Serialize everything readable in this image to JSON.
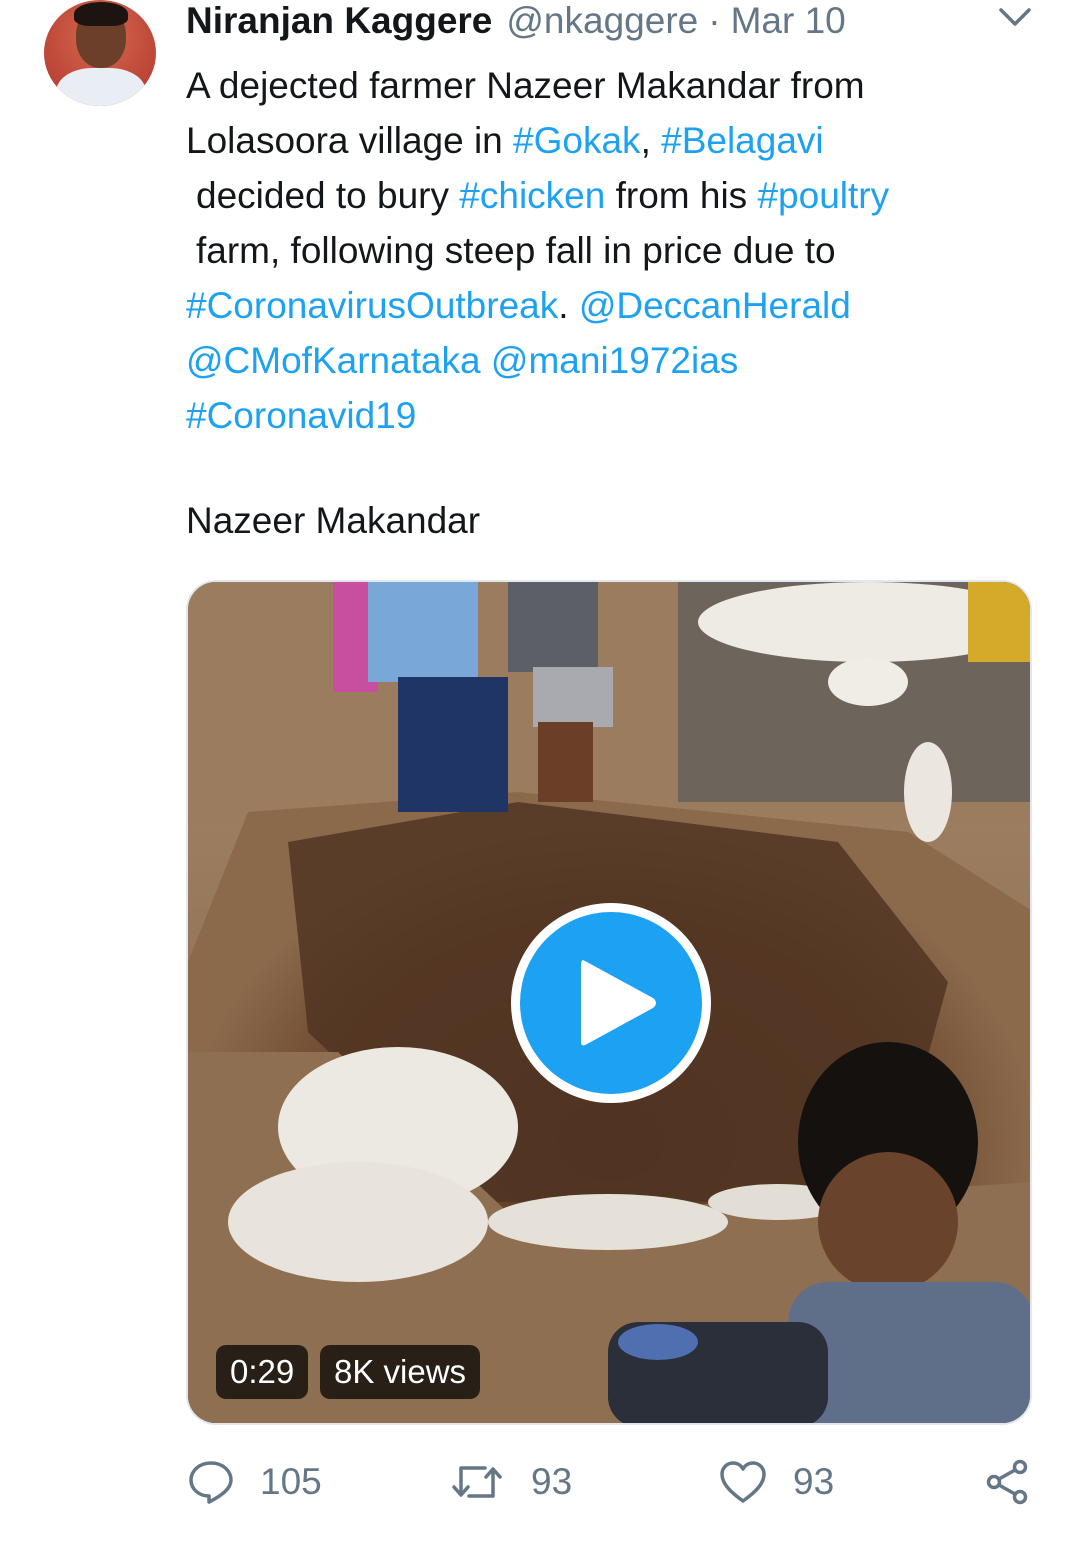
{
  "author": {
    "name": "Niranjan Kaggere",
    "handle": "@nkaggere",
    "separator": "·",
    "date": "Mar 10"
  },
  "tweet": {
    "lines": [
      [
        {
          "t": "A dejected farmer Nazeer Makandar from",
          "link": false
        }
      ],
      [
        {
          "t": "Lolasoora village in ",
          "link": false
        },
        {
          "t": "#Gokak",
          "link": true
        },
        {
          "t": ", ",
          "link": false
        },
        {
          "t": "#Belagavi",
          "link": true
        }
      ],
      [
        {
          "t": "decided to bury ",
          "link": false
        },
        {
          "t": "#chicken",
          "link": true
        },
        {
          "t": " from his ",
          "link": false
        },
        {
          "t": "#poultry",
          "link": true
        }
      ],
      [
        {
          "t": "farm, following steep fall in price due to",
          "link": false
        }
      ],
      [
        {
          "t": "#CoronavirusOutbreak",
          "link": true
        },
        {
          "t": ". ",
          "link": false
        },
        {
          "t": "@DeccanHerald",
          "link": true
        }
      ],
      [
        {
          "t": "@CMofKarnataka",
          "link": true
        },
        {
          "t": " ",
          "link": false
        },
        {
          "t": "@mani1972ias",
          "link": true
        }
      ],
      [
        {
          "t": "#Coronavid19",
          "link": true
        }
      ]
    ],
    "subtext": "Nazeer Makandar"
  },
  "media": {
    "duration": "0:29",
    "views": "8K views"
  },
  "actions": {
    "replies": "105",
    "retweets": "93",
    "likes": "93"
  },
  "icons": [
    "chevron-down-icon",
    "reply-icon",
    "retweet-icon",
    "like-icon",
    "share-icon",
    "play-icon"
  ],
  "colors": {
    "link": "#1da1f2",
    "muted": "#657786",
    "text": "#14171a"
  }
}
